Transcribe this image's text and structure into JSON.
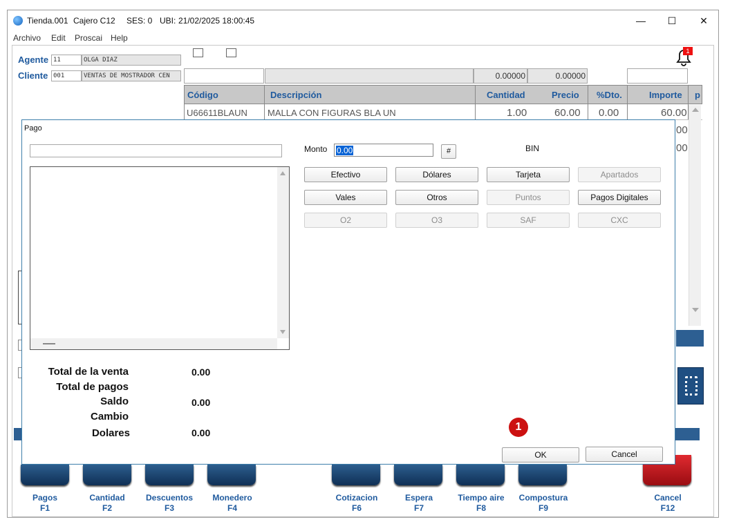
{
  "window": {
    "title_store": "Tienda.001",
    "title_cashier": "Cajero C12",
    "title_session": "SES: 0",
    "title_location": "UBI:",
    "title_datetime": "21/02/2025 18:00:45",
    "minimize": "—",
    "maximize": "☐",
    "close": "✕"
  },
  "menu": [
    "Archivo",
    "Edit",
    "Proscai",
    "Help"
  ],
  "header": {
    "agente_label": "Agente",
    "agente_code": "11",
    "agente_name": "OLGA DIAZ",
    "cliente_label": "Cliente",
    "cliente_code": "001",
    "cliente_name": "VENTAS DE MOSTRADOR CEN",
    "sum_cantidad": "0.00000",
    "sum_precio": "0.00000",
    "notification_count": "1"
  },
  "grid": {
    "columns": [
      "Código",
      "Descripción",
      "Cantidad",
      "Precio",
      "%Dto.",
      "Importe",
      "p"
    ],
    "rows": [
      {
        "codigo": "U66611BLAUN",
        "descripcion": "MALLA CON FIGURAS BLA UN",
        "cantidad": "1.00",
        "precio": "60.00",
        "dto": "0.00",
        "importe": "60.00"
      }
    ],
    "partial_importe_1": "00",
    "partial_importe_2": "00"
  },
  "function_keys": [
    {
      "label": "Pagos",
      "key": "F1"
    },
    {
      "label": "Cantidad",
      "key": "F2"
    },
    {
      "label": "Descuentos",
      "key": "F3"
    },
    {
      "label": "Monedero",
      "key": "F4"
    },
    {
      "label": "Cotizacion",
      "key": "F6"
    },
    {
      "label": "Espera",
      "key": "F7"
    },
    {
      "label": "Tiempo aire",
      "key": "F8"
    },
    {
      "label": "Compostura",
      "key": "F9"
    },
    {
      "label": "Cancel",
      "key": "F12"
    }
  ],
  "dialog": {
    "title": "Pago",
    "monto_label": "Monto",
    "monto_value": "0.00",
    "hash_button": "#",
    "bin_label": "BIN",
    "buttons": {
      "efectivo": "Efectivo",
      "dolares": "Dólares",
      "tarjeta": "Tarjeta",
      "apartados": "Apartados",
      "vales": "Vales",
      "otros": "Otros",
      "puntos": "Puntos",
      "pagos_digitales": "Pagos Digitales",
      "o2": "O2",
      "o3": "O3",
      "saf": "SAF",
      "cxc": "CXC"
    },
    "totals": {
      "total_venta_label": "Total de la venta",
      "total_venta_value": "0.00",
      "total_pagos_label": "Total de pagos",
      "saldo_label": "Saldo",
      "saldo_value": "0.00",
      "cambio_label": "Cambio",
      "dolares_label": "Dolares",
      "dolares_value": "0.00"
    },
    "step_marker": "1",
    "ok": "OK",
    "cancel": "Cancel"
  },
  "colors": {
    "accent_blue": "#1f5a9e",
    "dialog_border": "#3d7eaa",
    "function_key_blue": "#0f2f55",
    "cancel_red": "#c0121a",
    "marker_red": "#cc1111"
  }
}
